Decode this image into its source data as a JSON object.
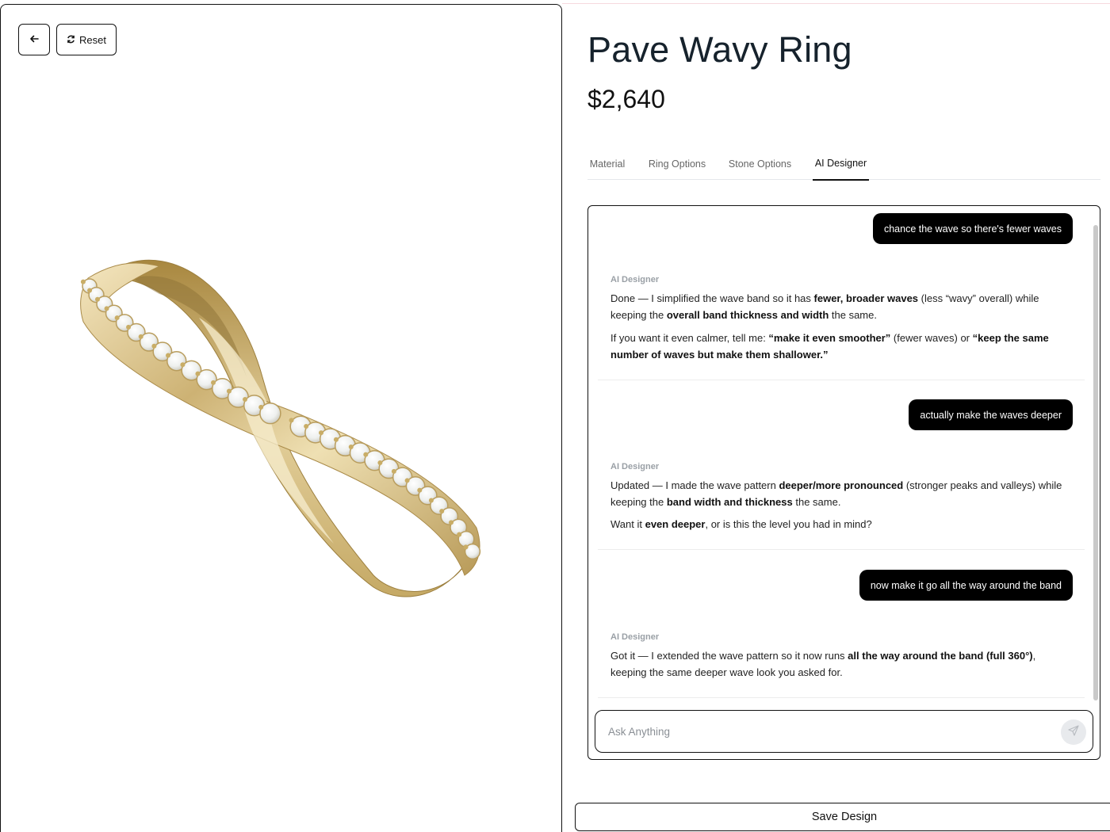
{
  "viewer": {
    "reset_label": "Reset"
  },
  "product": {
    "title": "Pave Wavy Ring",
    "price": "$2,640"
  },
  "tabs": [
    {
      "label": "Material",
      "active": false
    },
    {
      "label": "Ring Options",
      "active": false
    },
    {
      "label": "Stone Options",
      "active": false
    },
    {
      "label": "AI Designer",
      "active": true
    }
  ],
  "chat": {
    "ai_name": "AI Designer",
    "messages": [
      {
        "role": "user",
        "text": "chance the wave so there's fewer waves"
      },
      {
        "role": "ai",
        "paragraphs": [
          [
            "Done — I simplified the wave band so it has ",
            {
              "b": "fewer, broader waves"
            },
            " (less “wavy” overall) while keeping the ",
            {
              "b": "overall band thickness and width"
            },
            " the same."
          ],
          [
            "If you want it even calmer, tell me: ",
            {
              "b": "“make it even smoother”"
            },
            " (fewer waves) or ",
            {
              "b": "“keep the same number of waves but make them shallower.”"
            }
          ]
        ]
      },
      {
        "role": "user",
        "text": "actually make the waves deeper"
      },
      {
        "role": "ai",
        "paragraphs": [
          [
            "Updated — I made the wave pattern ",
            {
              "b": "deeper/more pronounced"
            },
            " (stronger peaks and valleys) while keeping the ",
            {
              "b": "band width and thickness"
            },
            " the same."
          ],
          [
            "Want it ",
            {
              "b": "even deeper"
            },
            ", or is this the level you had in mind?"
          ]
        ]
      },
      {
        "role": "user",
        "text": "now make it go all the way around the band"
      },
      {
        "role": "ai",
        "paragraphs": [
          [
            "Got it — I extended the wave pattern so it now runs ",
            {
              "b": "all the way around the band (full 360°)"
            },
            ", keeping the same deeper wave look you asked for."
          ]
        ]
      }
    ],
    "input_placeholder": "Ask Anything"
  },
  "actions": {
    "save_label": "Save Design"
  },
  "colors": {
    "user_bubble": "#000000",
    "ring_gold": "#d4bd86",
    "ai_label": "#9aa0a6"
  },
  "icons": {
    "back": "arrow-left-icon",
    "reset": "refresh-icon",
    "send": "send-icon"
  }
}
